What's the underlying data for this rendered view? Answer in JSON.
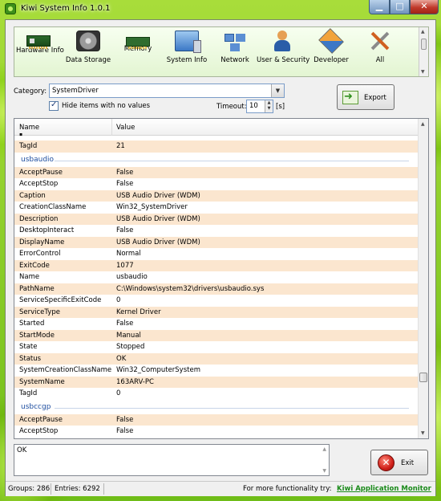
{
  "window": {
    "title": "Kiwi System Info 1.0.1"
  },
  "toolbar": {
    "items": [
      {
        "label": "Hardware Info",
        "icon": "hardware-icon"
      },
      {
        "label": "Data Storage",
        "icon": "hard-drive-icon"
      },
      {
        "label": "Memory",
        "icon": "memory-icon"
      },
      {
        "label": "System Info",
        "icon": "system-icon"
      },
      {
        "label": "Network",
        "icon": "network-icon"
      },
      {
        "label": "User & Security",
        "icon": "user-icon"
      },
      {
        "label": "Developer",
        "icon": "developer-icon"
      },
      {
        "label": "All",
        "icon": "tools-icon"
      }
    ]
  },
  "filters": {
    "category_label": "Category:",
    "category_value": "SystemDriver",
    "hide_empty_label": "Hide items with no values",
    "hide_empty_checked": true,
    "timeout_label": "Timeout:",
    "timeout_value": "10",
    "timeout_unit": "[s]",
    "export_label": "Export"
  },
  "grid": {
    "col_name": "Name",
    "col_value": "Value",
    "top_rows": [
      {
        "name": "TagId",
        "value": "21"
      }
    ],
    "groups": [
      {
        "title": "usbaudio",
        "rows": [
          {
            "name": "AcceptPause",
            "value": "False"
          },
          {
            "name": "AcceptStop",
            "value": "False"
          },
          {
            "name": "Caption",
            "value": "USB Audio Driver (WDM)"
          },
          {
            "name": "CreationClassName",
            "value": "Win32_SystemDriver"
          },
          {
            "name": "Description",
            "value": "USB Audio Driver (WDM)"
          },
          {
            "name": "DesktopInteract",
            "value": "False"
          },
          {
            "name": "DisplayName",
            "value": "USB Audio Driver (WDM)"
          },
          {
            "name": "ErrorControl",
            "value": "Normal"
          },
          {
            "name": "ExitCode",
            "value": "1077"
          },
          {
            "name": "Name",
            "value": "usbaudio"
          },
          {
            "name": "PathName",
            "value": "C:\\Windows\\system32\\drivers\\usbaudio.sys"
          },
          {
            "name": "ServiceSpecificExitCode",
            "value": "0"
          },
          {
            "name": "ServiceType",
            "value": "Kernel Driver"
          },
          {
            "name": "Started",
            "value": "False"
          },
          {
            "name": "StartMode",
            "value": "Manual"
          },
          {
            "name": "State",
            "value": "Stopped"
          },
          {
            "name": "Status",
            "value": "OK"
          },
          {
            "name": "SystemCreationClassName",
            "value": "Win32_ComputerSystem"
          },
          {
            "name": "SystemName",
            "value": "163ARV-PC"
          },
          {
            "name": "TagId",
            "value": "0"
          }
        ]
      },
      {
        "title": "usbccgp",
        "rows": [
          {
            "name": "AcceptPause",
            "value": "False"
          },
          {
            "name": "AcceptStop",
            "value": "False"
          }
        ]
      }
    ]
  },
  "output": {
    "text": "OK"
  },
  "exit_label": "Exit",
  "statusbar": {
    "groups": "Groups: 286",
    "entries": "Entries: 6292",
    "promo_text": "For more functionality try:",
    "promo_link": "Kiwi Application Monitor"
  },
  "colors": {
    "row_alt": "#fbe6cf",
    "group_title": "#1f4fa0",
    "link": "#1a8a1a"
  }
}
